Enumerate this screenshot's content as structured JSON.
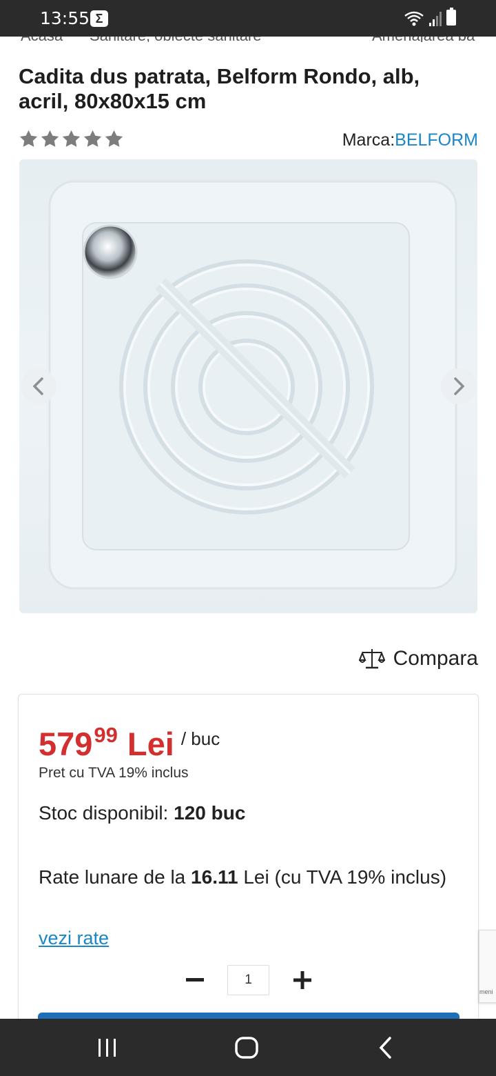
{
  "status_bar": {
    "time": "13:55",
    "notification_icon": "sigma-icon"
  },
  "breadcrumb": [
    "Acasa",
    "Sanitare, obiecte sanitare",
    "Amenajarea ba"
  ],
  "product": {
    "title": "Cadita dus patrata, Belform Rondo, alb, acril, 80x80x15 cm",
    "rating_stars": 5,
    "brand_label": "Marca:",
    "brand_name": "BELFORM"
  },
  "compare": {
    "label": "Compara",
    "icon": "scales-icon"
  },
  "price": {
    "integer": "579",
    "decimals": "99",
    "currency": "Lei",
    "unit": "/ buc",
    "vat_note": "Pret cu TVA 19% inclus"
  },
  "stock": {
    "label": "Stoc disponibil:",
    "value": "120 buc"
  },
  "installments": {
    "prefix": "Rate lunare de la",
    "amount": "16.11",
    "suffix": "Lei (cu TVA 19% inclus)",
    "link": "vezi rate"
  },
  "quantity": {
    "value": "1"
  },
  "recaptcha": {
    "text": "meni"
  },
  "colors": {
    "accent": "#1a86c7",
    "price": "#d32f2f",
    "button": "#1f6fb8"
  }
}
